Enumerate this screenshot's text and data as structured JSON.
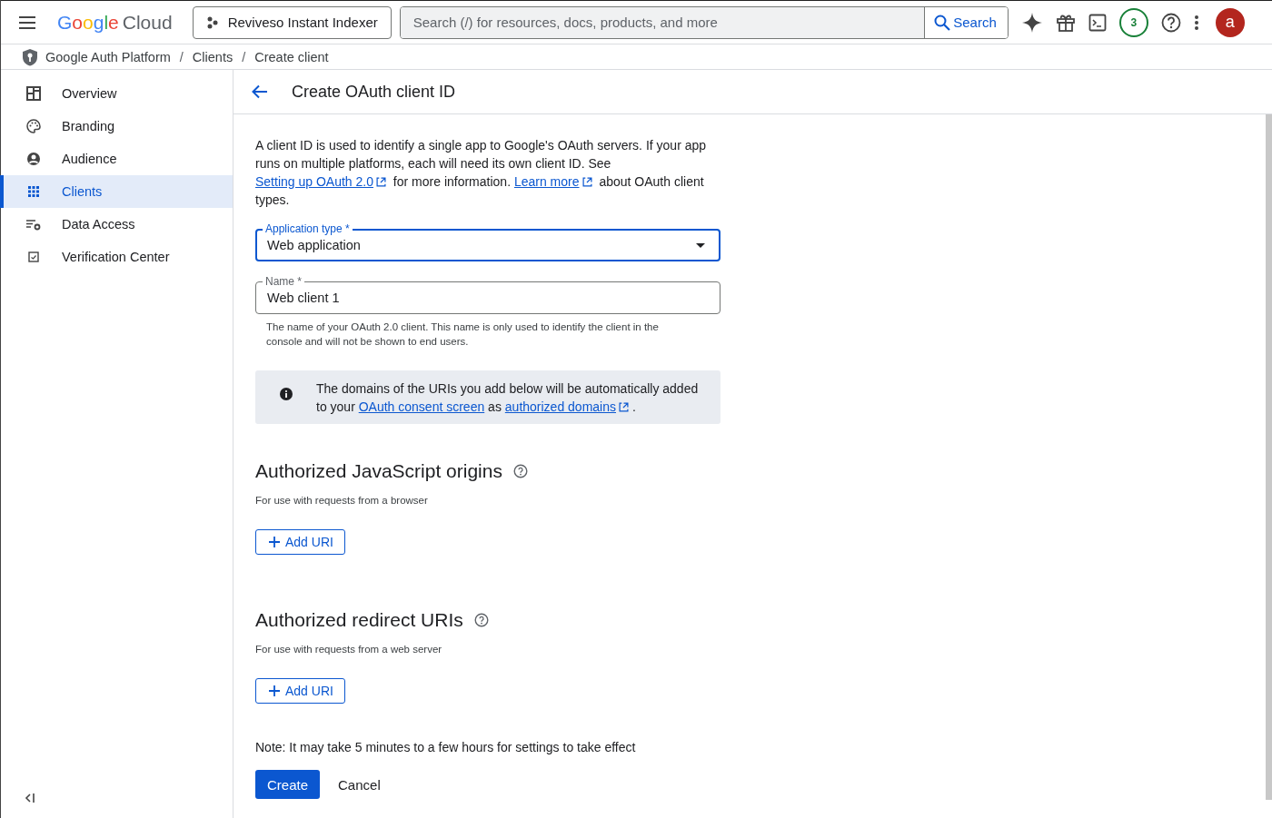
{
  "topbar": {
    "logo_google": "Google",
    "logo_cloud": "Cloud",
    "project": "Reviveso Instant Indexer",
    "search_placeholder": "Search (/) for resources, docs, products, and more",
    "search_button": "Search",
    "notifications": "3",
    "avatar": "a"
  },
  "breadcrumb": {
    "separator": "/",
    "items": [
      "Google Auth Platform",
      "Clients",
      "Create client"
    ]
  },
  "sidebar": {
    "items": [
      {
        "label": "Overview",
        "kind": "dashboard",
        "selected": false
      },
      {
        "label": "Branding",
        "kind": "palette",
        "selected": false
      },
      {
        "label": "Audience",
        "kind": "person",
        "selected": false
      },
      {
        "label": "Clients",
        "kind": "grid",
        "selected": true
      },
      {
        "label": "Data Access",
        "kind": "settings",
        "selected": false
      },
      {
        "label": "Verification Center",
        "kind": "checkbox",
        "selected": false
      }
    ]
  },
  "page_title": "Create OAuth client ID",
  "intro": [
    {
      "kind": "text",
      "text": "A client ID is used to identify a single app to Google's OAuth servers. If your app runs on multiple platforms, each will need its own client ID. See "
    },
    {
      "kind": "link",
      "text": "Setting up OAuth 2.0",
      "external": true
    },
    {
      "kind": "text",
      "text": " for more information. "
    },
    {
      "kind": "link",
      "text": "Learn more",
      "external": true
    },
    {
      "kind": "text",
      "text": " about OAuth client types."
    }
  ],
  "application_type": {
    "label": "Application type *",
    "value": "Web application",
    "focused": true
  },
  "name_field": {
    "label": "Name *",
    "value": "Web client 1",
    "hint": "The name of your OAuth 2.0 client. This name is only used to identify the client in the console and will not be shown to end users."
  },
  "info": [
    {
      "kind": "text",
      "text": "The domains of the URIs you add below will be automatically added to your "
    },
    {
      "kind": "link",
      "text": "OAuth consent screen",
      "external": false
    },
    {
      "kind": "text",
      "text": " as "
    },
    {
      "kind": "link",
      "text": "authorized domains",
      "external": true
    },
    {
      "kind": "text",
      "text": "."
    }
  ],
  "sections": [
    {
      "title": "Authorized JavaScript origins",
      "subtitle": "For use with requests from a browser",
      "button": "Add URI"
    },
    {
      "title": "Authorized redirect URIs",
      "subtitle": "For use with requests from a web server",
      "button": "Add URI"
    }
  ],
  "note": "Note: It may take 5 minutes to a few hours for settings to take effect",
  "actions": [
    {
      "label": "Create",
      "kind": "primary"
    },
    {
      "label": "Cancel",
      "kind": "text"
    }
  ]
}
